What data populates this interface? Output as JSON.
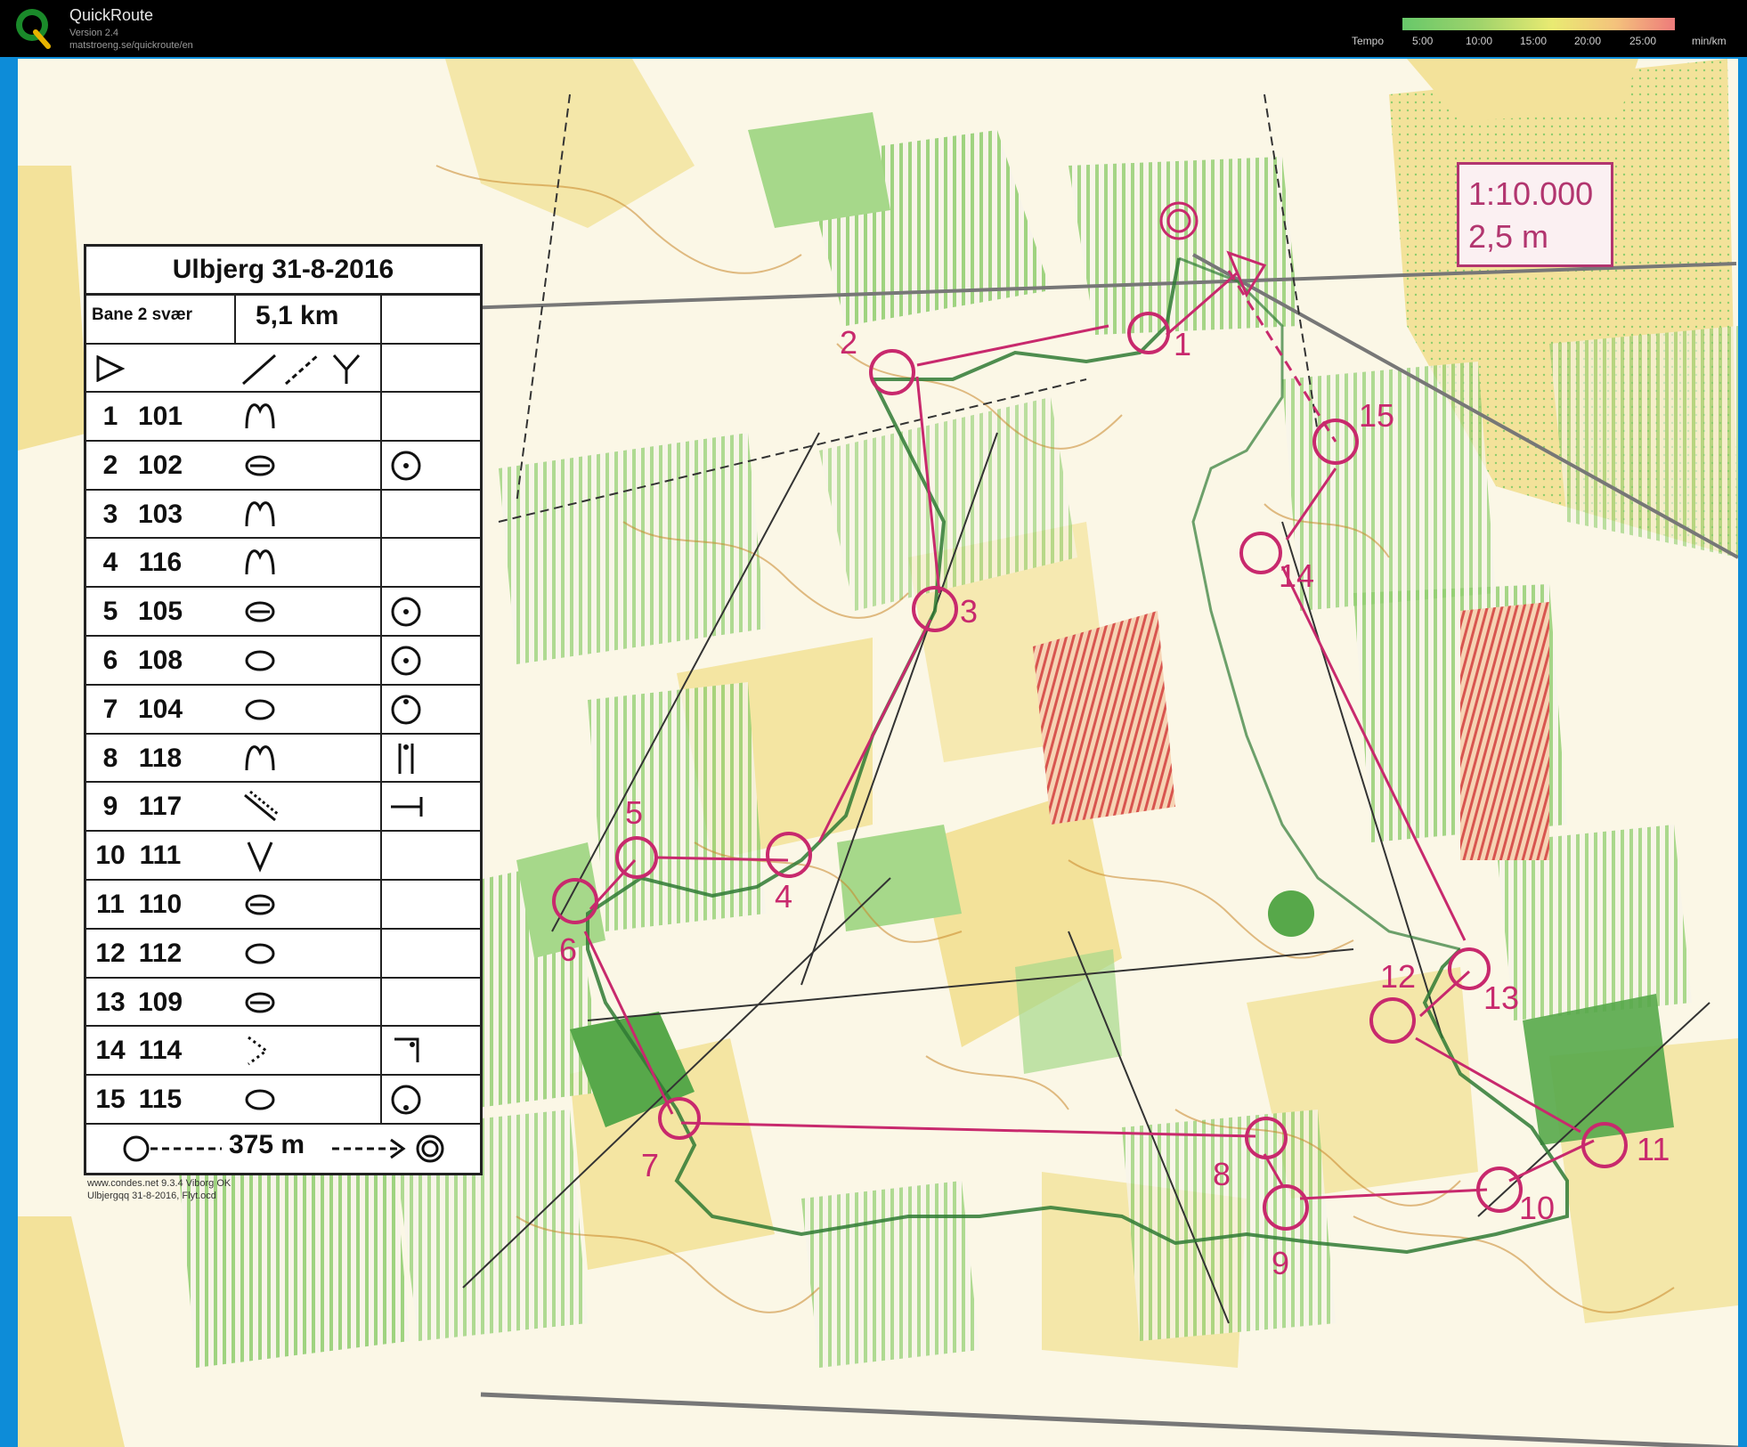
{
  "app": {
    "name": "QuickRoute",
    "version": "Version 2.4",
    "url": "matstroeng.se/quickroute/en"
  },
  "tempo": {
    "label": "Tempo",
    "ticks": [
      "5:00",
      "10:00",
      "15:00",
      "20:00",
      "25:00"
    ],
    "unit": "min/km"
  },
  "scale": {
    "ratio": "1:10.000",
    "contour": "2,5 m"
  },
  "sheet": {
    "title": "Ulbjerg 31-8-2016",
    "course": "Bane 2 svær",
    "length": "5,1 km",
    "controls": [
      {
        "num": "1",
        "code": "101",
        "symbol": "knoll-icon",
        "extra": ""
      },
      {
        "num": "2",
        "code": "102",
        "symbol": "depression-icon",
        "extra": "center-icon"
      },
      {
        "num": "3",
        "code": "103",
        "symbol": "knoll-icon",
        "extra": ""
      },
      {
        "num": "4",
        "code": "116",
        "symbol": "knoll-icon",
        "extra": ""
      },
      {
        "num": "5",
        "code": "105",
        "symbol": "depression-icon",
        "extra": "center-icon"
      },
      {
        "num": "6",
        "code": "108",
        "symbol": "small-depression-icon",
        "extra": "center-icon"
      },
      {
        "num": "7",
        "code": "104",
        "symbol": "small-depression-icon",
        "extra": "side-icon"
      },
      {
        "num": "8",
        "code": "118",
        "symbol": "knoll-icon",
        "extra": "between-icon"
      },
      {
        "num": "9",
        "code": "117",
        "symbol": "ditch-icon",
        "extra": "end-icon"
      },
      {
        "num": "10",
        "code": "111",
        "symbol": "gully-icon",
        "extra": ""
      },
      {
        "num": "11",
        "code": "110",
        "symbol": "depression-icon",
        "extra": ""
      },
      {
        "num": "12",
        "code": "112",
        "symbol": "small-depression-icon",
        "extra": ""
      },
      {
        "num": "13",
        "code": "109",
        "symbol": "depression-icon",
        "extra": ""
      },
      {
        "num": "14",
        "code": "114",
        "symbol": "vegetation-corner-icon",
        "extra": "corner-icon"
      },
      {
        "num": "15",
        "code": "115",
        "symbol": "small-depression-icon",
        "extra": "foot-icon"
      }
    ],
    "finish_distance": "375 m",
    "credits": [
      "www.condes.net 9.3.4 Viborg OK",
      "Ulbjergqq 31-8-2016, Flyt.ocd"
    ]
  },
  "course_controls": [
    {
      "label": "1"
    },
    {
      "label": "2"
    },
    {
      "label": "3"
    },
    {
      "label": "4"
    },
    {
      "label": "5"
    },
    {
      "label": "6"
    },
    {
      "label": "7"
    },
    {
      "label": "8"
    },
    {
      "label": "9"
    },
    {
      "label": "10"
    },
    {
      "label": "11"
    },
    {
      "label": "12"
    },
    {
      "label": "13"
    },
    {
      "label": "14"
    },
    {
      "label": "15"
    }
  ],
  "colors": {
    "course": "#c8296d",
    "route": "#2f7a34",
    "forest_green": "#8fcd6e",
    "open_yellow": "#f3e29a",
    "contour": "#c9862a"
  }
}
